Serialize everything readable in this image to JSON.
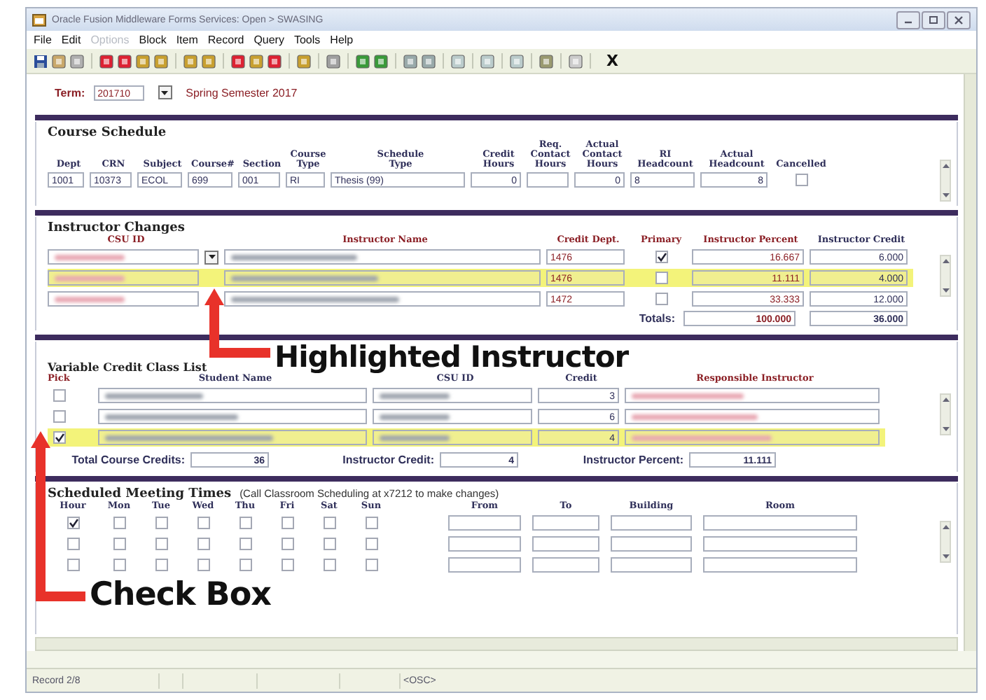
{
  "window": {
    "title": "Oracle Fusion Middleware Forms Services: Open > SWASING"
  },
  "menu": [
    {
      "label": "File",
      "disabled": false
    },
    {
      "label": "Edit",
      "disabled": false
    },
    {
      "label": "Options",
      "disabled": true
    },
    {
      "label": "Block",
      "disabled": false
    },
    {
      "label": "Item",
      "disabled": false
    },
    {
      "label": "Record",
      "disabled": false
    },
    {
      "label": "Query",
      "disabled": false
    },
    {
      "label": "Tools",
      "disabled": false
    },
    {
      "label": "Help",
      "disabled": false
    }
  ],
  "toolbar": {
    "exit_label": "X"
  },
  "term": {
    "label": "Term:",
    "value": "201710",
    "description": "Spring Semester 2017"
  },
  "course_schedule": {
    "title": "Course Schedule",
    "columns": [
      "Dept",
      "CRN",
      "Subject",
      "Course#",
      "Section",
      "Course\nType",
      "Schedule\nType",
      "Credit\nHours",
      "Req.\nContact\nHours",
      "Actual\nContact\nHours",
      "RI\nHeadcount",
      "Actual\nHeadcount",
      "Cancelled"
    ],
    "fields": [
      {
        "kind": "text",
        "value": "1001"
      },
      {
        "kind": "text",
        "value": "10373"
      },
      {
        "kind": "text",
        "value": "ECOL"
      },
      {
        "kind": "text",
        "value": "699"
      },
      {
        "kind": "text",
        "value": "001"
      },
      {
        "kind": "text",
        "value": "RI"
      },
      {
        "kind": "text",
        "value": "Thesis (99)"
      },
      {
        "kind": "number",
        "value": "0"
      },
      {
        "kind": "text"
      },
      {
        "kind": "number",
        "value": "0"
      },
      {
        "kind": "text",
        "value": "8"
      },
      {
        "kind": "number",
        "value": "8"
      },
      {
        "kind": "checkbox",
        "checked": false
      }
    ]
  },
  "instructor_changes": {
    "title": "Instructor Changes",
    "columns": [
      {
        "label": "CSU ID",
        "required": true
      },
      {
        "label": "Instructor Name",
        "required": true
      },
      {
        "label": "Credit Dept.",
        "required": true
      },
      {
        "label": "Primary",
        "required": true
      },
      {
        "label": "Instructor Percent",
        "required": true
      },
      {
        "label": "Instructor Credit",
        "required": false
      }
    ],
    "rows": [
      {
        "selected": false,
        "credit_dept": "1476",
        "primary": true,
        "percent": "16.667",
        "credit": "6.000"
      },
      {
        "selected": true,
        "credit_dept": "1476",
        "primary": false,
        "percent": "11.111",
        "credit": "4.000"
      },
      {
        "selected": false,
        "credit_dept": "1472",
        "primary": false,
        "percent": "33.333",
        "credit": "12.000"
      }
    ],
    "totals": {
      "label": "Totals:",
      "percent": "100.000",
      "credit": "36.000"
    }
  },
  "variable_credit": {
    "title": "Variable Credit Class List",
    "columns": [
      {
        "label": "Pick",
        "required": true
      },
      {
        "label": "Student Name",
        "required": false
      },
      {
        "label": "CSU ID",
        "required": false
      },
      {
        "label": "Credit",
        "required": false
      },
      {
        "label": "Responsible Instructor",
        "required": true
      }
    ],
    "rows": [
      {
        "selected": false,
        "pick": false,
        "credit": "3"
      },
      {
        "selected": false,
        "pick": false,
        "credit": "6"
      },
      {
        "selected": true,
        "pick": true,
        "credit": "4"
      }
    ],
    "summary": [
      {
        "label": "Total Course Credits:",
        "value": "36"
      },
      {
        "label": "Instructor Credit:",
        "value": "4"
      },
      {
        "label": "Instructor Percent:",
        "value": "11.111"
      }
    ]
  },
  "meeting_times": {
    "title": "Scheduled Meeting Times",
    "note": "(Call Classroom Scheduling at x7212 to make changes)",
    "columns": [
      "Hour",
      "Mon",
      "Tue",
      "Wed",
      "Thu",
      "Fri",
      "Sat",
      "Sun",
      "From",
      "To",
      "Building",
      "Room"
    ],
    "rows": [
      {
        "checks": [
          true,
          false,
          false,
          false,
          false,
          false,
          false,
          false
        ]
      },
      {
        "checks": [
          false,
          false,
          false,
          false,
          false,
          false,
          false,
          false
        ]
      },
      {
        "checks": [
          false,
          false,
          false,
          false,
          false,
          false,
          false,
          false
        ]
      }
    ]
  },
  "status_bar": {
    "record": "Record 2/8",
    "mode": "<OSC>"
  },
  "annotations": [
    {
      "text": "Highlighted Instructor"
    },
    {
      "text": "Check Box"
    }
  ]
}
